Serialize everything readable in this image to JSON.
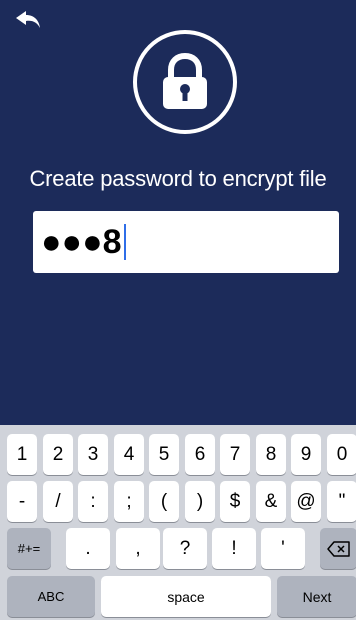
{
  "prompt": "Create password to encrypt file",
  "password_field": {
    "value": "●●●8"
  },
  "icons": {
    "back": "back-arrow-icon",
    "lock": "lock-icon",
    "delete": "backspace-icon"
  },
  "colors": {
    "background": "#1c2b5a",
    "keyboard": "#d0d3da",
    "caret": "#2f6ee8"
  },
  "keyboard": {
    "row1": [
      "1",
      "2",
      "3",
      "4",
      "5",
      "6",
      "7",
      "8",
      "9",
      "0"
    ],
    "row2": [
      "-",
      "/",
      ":",
      ";",
      "(",
      ")",
      "$",
      "&",
      "@",
      "\""
    ],
    "row3_left": "#+=",
    "row3": [
      ".",
      ",",
      "?",
      "!",
      "'"
    ],
    "abc": "ABC",
    "space": "space",
    "next": "Next"
  }
}
